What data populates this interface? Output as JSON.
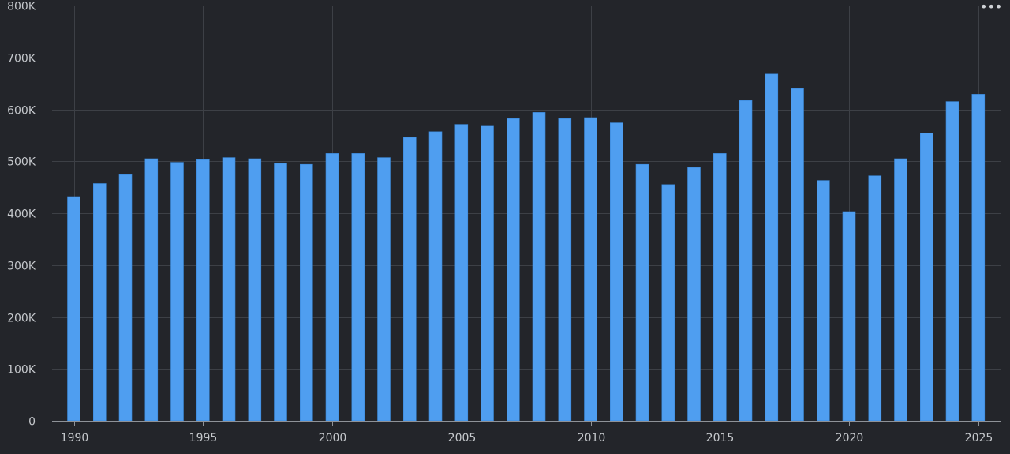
{
  "chart_data": {
    "type": "bar",
    "title": "",
    "xlabel": "",
    "ylabel": "",
    "x": [
      1990,
      1991,
      1992,
      1993,
      1994,
      1995,
      1996,
      1997,
      1998,
      1999,
      2000,
      2001,
      2002,
      2003,
      2004,
      2005,
      2006,
      2007,
      2008,
      2009,
      2010,
      2011,
      2012,
      2013,
      2014,
      2015,
      2016,
      2017,
      2018,
      2019,
      2020,
      2021,
      2022,
      2023,
      2024,
      2025
    ],
    "values": [
      432000,
      457000,
      474000,
      505000,
      498000,
      503000,
      507000,
      505000,
      496000,
      494000,
      515000,
      515000,
      507000,
      546000,
      557000,
      571000,
      569000,
      582000,
      594000,
      582000,
      584000,
      574000,
      494000,
      455000,
      488000,
      515000,
      617000,
      668000,
      640000,
      463000,
      403000,
      472000,
      505000,
      554000,
      615000,
      629000
    ],
    "ylim": [
      0,
      800000
    ],
    "yticks": [
      0,
      100000,
      200000,
      300000,
      400000,
      500000,
      600000,
      700000,
      800000
    ],
    "ytick_labels": [
      "0",
      "100K",
      "200K",
      "300K",
      "400K",
      "500K",
      "600K",
      "700K",
      "800K"
    ],
    "xticks": [
      1990,
      1995,
      2000,
      2005,
      2010,
      2015,
      2020,
      2025
    ],
    "xtick_labels": [
      "1990",
      "1995",
      "2000",
      "2005",
      "2010",
      "2015",
      "2020",
      "2025"
    ],
    "grid": true,
    "legend": "none"
  },
  "colors": {
    "background": "#23252a",
    "bar": "#4f9ef0",
    "bar_edge": "#3a87d8",
    "grid": "#3d4046",
    "axis": "#8e9298",
    "tick_text": "#c5c8cc"
  },
  "toolbar": {
    "menu_icon": "more-horizontal-icon",
    "menu_glyph": "•••"
  }
}
